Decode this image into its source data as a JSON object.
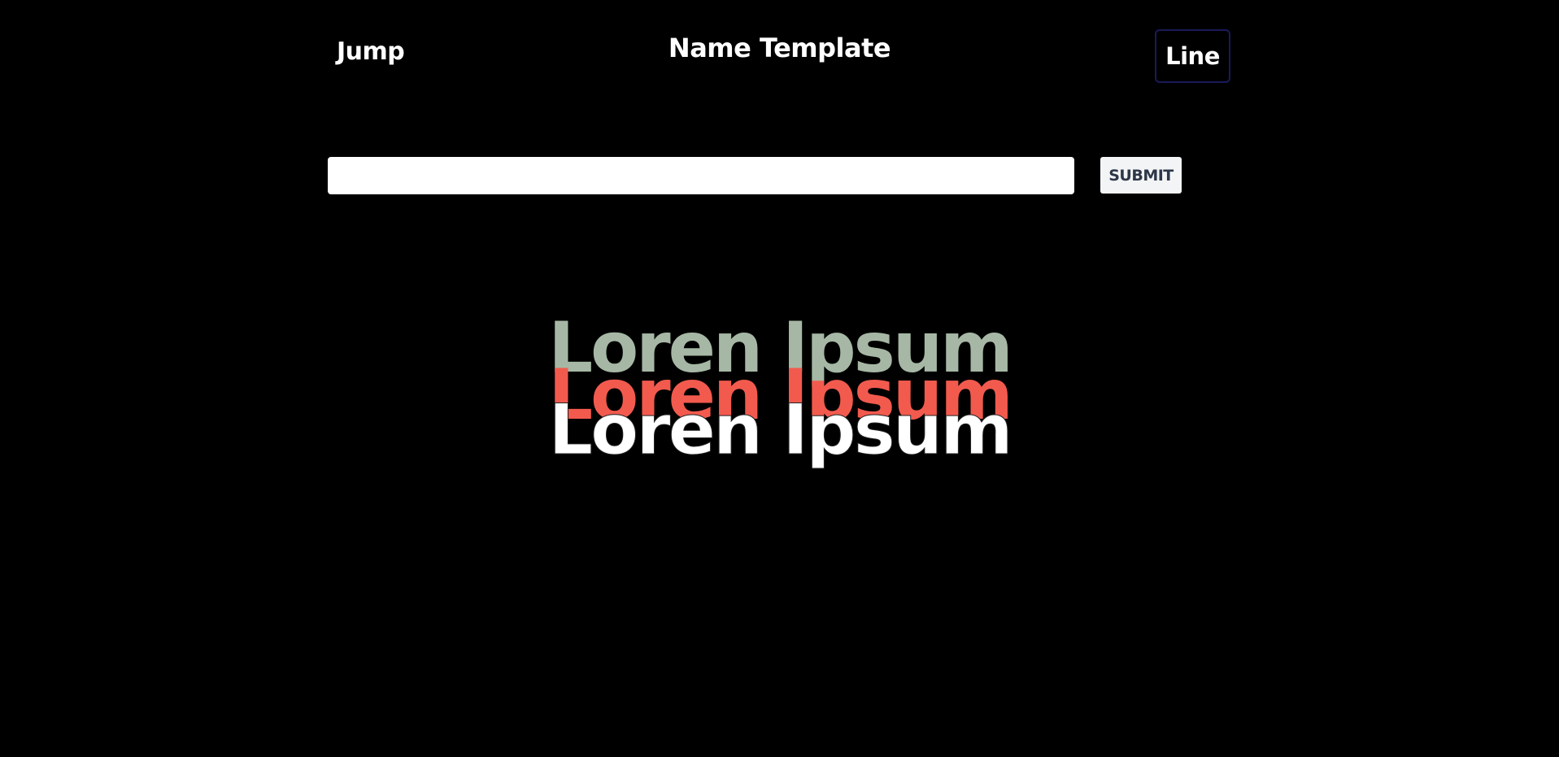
{
  "nav": {
    "jump_label": "Jump",
    "title": "Name Template",
    "line_label": "Line"
  },
  "form": {
    "input_value": "",
    "input_placeholder": "",
    "submit_label": "SUBMIT"
  },
  "display": {
    "layers": [
      {
        "text": "Loren Ipsum",
        "color": "#a6b8a5"
      },
      {
        "text": "Loren Ipsum",
        "color": "#f25a4e"
      },
      {
        "text": "Loren Ipsum",
        "color": "#ffffff"
      }
    ]
  },
  "colors": {
    "background": "#000000",
    "line_button_border": "#1a1a5a",
    "submit_background": "#f3f4f6",
    "submit_text": "#2d3748"
  }
}
